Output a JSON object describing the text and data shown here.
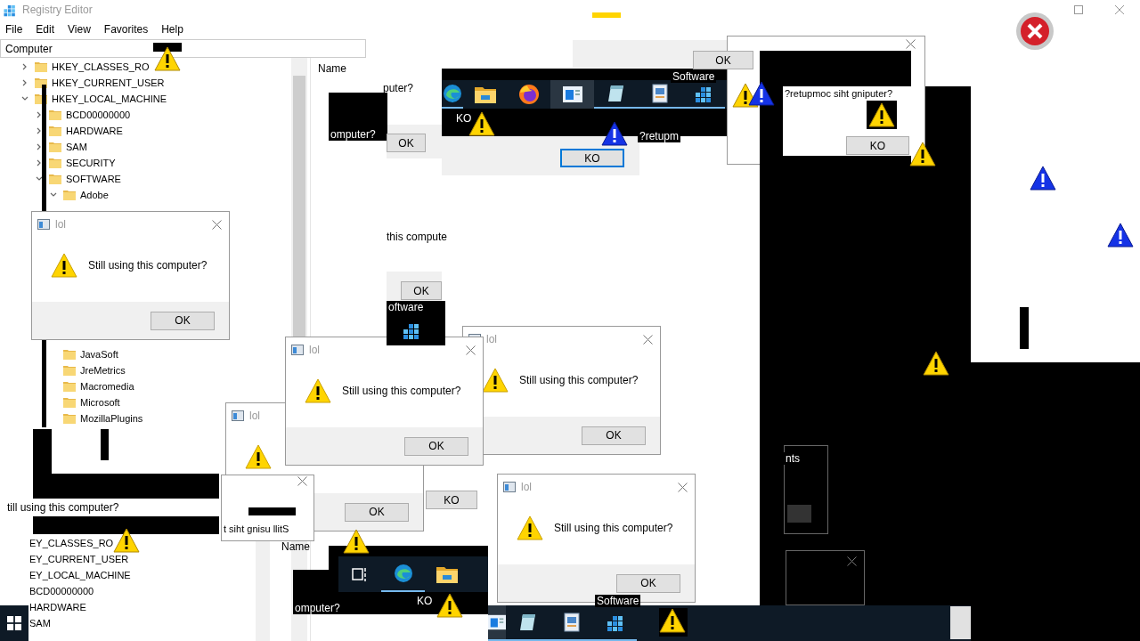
{
  "registry_editor": {
    "title": "Registry Editor",
    "menu": [
      "File",
      "Edit",
      "View",
      "Favorites",
      "Help"
    ],
    "address": "Computer",
    "column_header": "Name",
    "tree": [
      {
        "label": "HKEY_CLASSES_RO",
        "expanded": false
      },
      {
        "label": "HKEY_CURRENT_USER",
        "expanded": false
      },
      {
        "label": "HKEY_LOCAL_MACHINE",
        "expanded": true,
        "children": [
          {
            "label": "BCD00000000",
            "expanded": false
          },
          {
            "label": "HARDWARE",
            "expanded": false
          },
          {
            "label": "SAM",
            "expanded": false
          },
          {
            "label": "SECURITY",
            "expanded": false
          },
          {
            "label": "SOFTWARE",
            "expanded": true,
            "children": [
              {
                "label": "Adobe",
                "expanded": true
              },
              {
                "label": "JavaSoft"
              },
              {
                "label": "JreMetrics"
              },
              {
                "label": "Macromedia"
              },
              {
                "label": "Microsoft"
              },
              {
                "label": "MozillaPlugins"
              }
            ]
          }
        ]
      }
    ]
  },
  "registry_editor_copy": {
    "column_header": "Name",
    "tree_items": [
      "EY_CLASSES_RO",
      "EY_CURRENT_USER",
      "EY_LOCAL_MACHINE",
      "BCD00000000",
      "HARDWARE",
      "SAM"
    ]
  },
  "dialogs": [
    {
      "title": "lol",
      "button": "OK"
    },
    {
      "title": "lol",
      "message": "Still using this computer?",
      "button": "OK"
    },
    {
      "title": "lol",
      "message": "Still using this computer?",
      "button": "OK"
    },
    {
      "title": "lol",
      "message": "Still using this computer?",
      "button": "OK"
    },
    {
      "title": "lol",
      "message": "Still using this computer?",
      "button": "OK"
    }
  ],
  "focus_dialog": {
    "button": "KO",
    "focused": true
  },
  "reversed_dialog": {
    "message": "?retupmoc siht gniputer?",
    "button": "KO"
  },
  "mirrored_dialog": {
    "message": "t siht gnisu llitS"
  },
  "fragments": [
    {
      "kind": "dark_text",
      "text": "omputer?"
    },
    {
      "kind": "text",
      "text": "puter?"
    },
    {
      "kind": "button",
      "text": "OK"
    },
    {
      "kind": "text",
      "text": "this compute"
    },
    {
      "kind": "button",
      "text": "OK"
    },
    {
      "kind": "dark_text",
      "text": "oftware"
    },
    {
      "kind": "text",
      "text": "till using this computer?"
    },
    {
      "kind": "dark_text",
      "text": "omputer?"
    },
    {
      "kind": "dark_text",
      "text": "KO"
    },
    {
      "kind": "dark_text",
      "text": "Software"
    },
    {
      "kind": "dark_text",
      "text": "Software"
    },
    {
      "kind": "dark_text",
      "text": "KO"
    },
    {
      "kind": "dark_text",
      "text": "?retupm"
    },
    {
      "kind": "dark_text",
      "text": "nts"
    },
    {
      "kind": "button",
      "text": "KO"
    },
    {
      "kind": "button",
      "text": "OK"
    }
  ]
}
